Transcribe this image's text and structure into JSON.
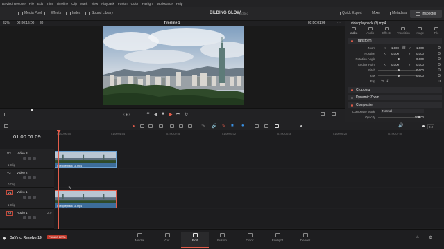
{
  "menubar": {
    "items": [
      "DaVinci Resolve",
      "File",
      "Edit",
      "Trim",
      "Timeline",
      "Clip",
      "Mark",
      "View",
      "Playback",
      "Fusion",
      "Color",
      "Fairlight",
      "Workspace",
      "Help"
    ]
  },
  "toolbar": {
    "media_pool": "Media Pool",
    "effects": "Effects",
    "index": "Index",
    "sound_library": "Sound Library",
    "project_title": "BILDING GLOW",
    "project_status": "Edited",
    "quick_export": "Quick Export",
    "mixer": "Mixer",
    "metadata": "Metadata",
    "inspector": "Inspector"
  },
  "viewer": {
    "zoom": "32%",
    "source_tc": "00:00:16:00",
    "fps_field": "30",
    "timeline_name": "Timeline 1",
    "record_tc": "01:00:01:09"
  },
  "inspector": {
    "clip_name": "videoplayback (3).mp4",
    "tabs": [
      "Video",
      "Audio",
      "Effects",
      "Transition",
      "Image",
      "File"
    ],
    "transform_title": "Transform",
    "transform_rows": [
      {
        "label": "Zoom",
        "x": "1.000",
        "y": "1.000"
      },
      {
        "label": "Position",
        "x": "0.000",
        "y": "0.000"
      },
      {
        "label": "Rotation Angle",
        "value": "0.000"
      },
      {
        "label": "Anchor Point",
        "x": "0.000",
        "y": "0.000"
      },
      {
        "label": "Pitch",
        "value": "0.000"
      },
      {
        "label": "Yaw",
        "value": "0.000"
      },
      {
        "label": "Flip",
        "value": ""
      }
    ],
    "cropping": "Cropping",
    "dynamic_zoom": "Dynamic Zoom",
    "composite": "Composite",
    "composite_mode_label": "Composite Mode",
    "composite_mode_value": "Normal",
    "opacity_label": "Opacity",
    "opacity_value": "100.00"
  },
  "timeline": {
    "timecode": "01:00:01:09",
    "ruler_ticks": [
      "01:00:00:00",
      "01:00:01:04",
      "01:00:02:08",
      "01:00:03:12",
      "01:00:04:16",
      "01:00:05:20",
      "01:00:07:00"
    ],
    "tracks": [
      {
        "id": "V3",
        "name": "Video 3",
        "clips": "1 Clip"
      },
      {
        "id": "V2",
        "name": "Video 2",
        "clips": "0 Clip"
      },
      {
        "id": "V1",
        "name": "Video 1",
        "clips": "1 Clip"
      },
      {
        "id": "A1",
        "name": "Audio 1",
        "clips": "2.0"
      }
    ],
    "clip_v3": "videoplayback (3).mp4",
    "clip_v1": "videoplayback (3).mp4",
    "volume": "0.0"
  },
  "pagebar": {
    "brand": "DaVinci Resolve 19",
    "beta": "PUBLIC BETA",
    "pages": [
      "Media",
      "Cut",
      "Edit",
      "Fusion",
      "Color",
      "Fairlight",
      "Deliver"
    ],
    "active_page": "Edit"
  },
  "colors": {
    "accent": "#e25c4a",
    "clip_blue": "#3d6d9a",
    "background": "#1c1c1e"
  }
}
